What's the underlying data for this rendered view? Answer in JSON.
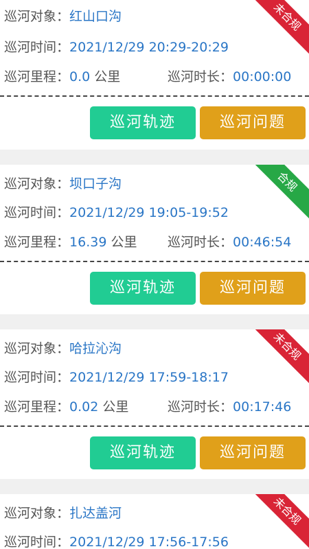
{
  "labels": {
    "target": "巡河对象：",
    "time": "巡河时间：",
    "distance": "巡河里程：",
    "duration": "巡河时长：",
    "unit_km": "公里"
  },
  "buttons": {
    "track": "巡河轨迹",
    "issue": "巡河问题"
  },
  "records": [
    {
      "target": "红山口沟",
      "time": "2021/12/29 20:29-20:29",
      "distance": "0.0",
      "duration": "00:00:00",
      "status": "未合规",
      "status_color": "#d92436"
    },
    {
      "target": "坝口子沟",
      "time": "2021/12/29 19:05-19:52",
      "distance": "16.39",
      "duration": "00:46:54",
      "status": "合规",
      "status_color": "#27a846"
    },
    {
      "target": "哈拉沁沟",
      "time": "2021/12/29 17:59-18:17",
      "distance": "0.02",
      "duration": "00:17:46",
      "status": "未合规",
      "status_color": "#d92436"
    },
    {
      "target": "扎达盖河",
      "time": "2021/12/29 17:56-17:56",
      "status": "未合规",
      "status_color": "#d92436"
    }
  ]
}
